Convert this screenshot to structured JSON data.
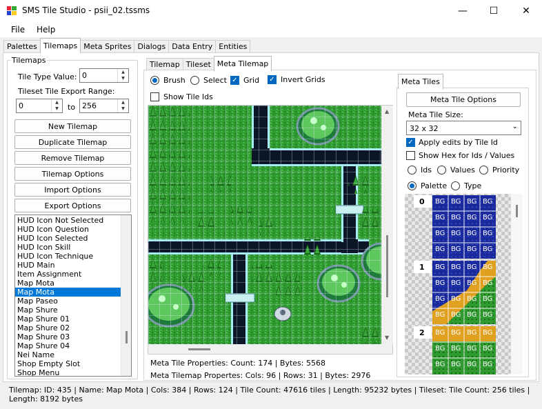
{
  "window": {
    "title": "SMS Tile Studio - psii_02.tssms"
  },
  "menu": [
    "File",
    "Help"
  ],
  "main_tabs": [
    "Palettes",
    "Tilemaps",
    "Meta Sprites",
    "Dialogs",
    "Data Entry",
    "Entities"
  ],
  "tilemaps_group": {
    "label": "Tilemaps",
    "tile_type_label": "Tile Type Value:",
    "tile_type_value": "0",
    "export_range_label": "Tileset Tile Export Range:",
    "range_from": "0",
    "range_to_label": "to",
    "range_to": "256",
    "buttons": [
      "New Tilemap",
      "Duplicate Tilemap",
      "Remove Tilemap",
      "Tilemap Options",
      "Import Options",
      "Export Options"
    ],
    "list": [
      "HUD Icon Not Selected",
      "HUD Icon Question",
      "HUD Icon Selected",
      "HUD Icon Skill",
      "HUD Icon Technique",
      "HUD Main",
      "Item Assignment",
      "Map Mota",
      "Map Mota",
      "Map Paseo",
      "Map Shure",
      "Map Shure 01",
      "Map Shure 02",
      "Map Shure 03",
      "Map Shure 04",
      "Nei Name",
      "Shop Empty Slot",
      "Shop Menu"
    ],
    "selected_index": 8
  },
  "sub_tabs": [
    "Tilemap",
    "Tileset",
    "Meta Tilemap"
  ],
  "toolbar": {
    "brush": "Brush",
    "select": "Select",
    "grid": "Grid",
    "invert_grids": "Invert Grids",
    "show_tile_ids": "Show Tile Ids"
  },
  "meta_info": {
    "tile_props": "Meta Tile Properties: Count: 174 | Bytes: 5568",
    "tilemap_props": "Meta Tilemap Propertes: Cols: 96 | Rows: 31 | Bytes: 2976"
  },
  "meta_tiles": {
    "tab": "Meta Tiles",
    "options_button": "Meta Tile Options",
    "size_label": "Meta Tile Size:",
    "size_value": "32 x 32",
    "apply_edits": "Apply edits by Tile Id",
    "show_hex": "Show Hex for Ids / Values",
    "radio_ids": "Ids",
    "radio_values": "Values",
    "radio_priority": "Priority",
    "radio_palette": "Palette",
    "radio_type": "Type",
    "tile_numbers": [
      "0",
      "1",
      "2"
    ],
    "bg_label": "BG"
  },
  "status_bar": "Tilemap: ID: 435 | Name: Map Mota | Cols: 384 | Rows: 124 | Tile Count: 47616 tiles | Length: 95232 bytes | Tileset: Tile Count: 256 tiles | Length: 8192 bytes",
  "colors": {
    "selection": "#0078d7",
    "accent": "#0067c0",
    "grass": "#2e9e2e",
    "road": "#101828",
    "pipe": "#9fe8f0",
    "water": "#1b2a9c"
  }
}
